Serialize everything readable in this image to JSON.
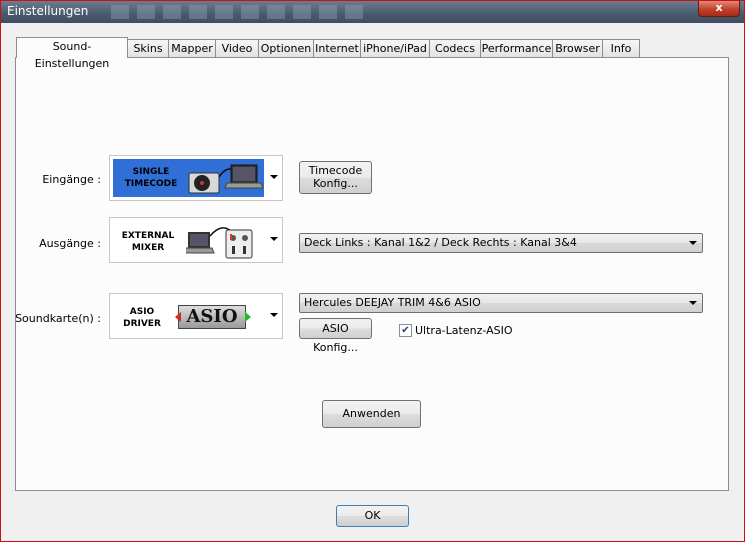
{
  "window": {
    "title": "Einstellungen",
    "close_glyph": "x"
  },
  "tabs": [
    {
      "label": "Sound-Einstellungen",
      "active": true
    },
    {
      "label": "Skins"
    },
    {
      "label": "Mapper"
    },
    {
      "label": "Video"
    },
    {
      "label": "Optionen"
    },
    {
      "label": "Internet"
    },
    {
      "label": "iPhone/iPad"
    },
    {
      "label": "Codecs"
    },
    {
      "label": "Performance"
    },
    {
      "label": "Browser"
    },
    {
      "label": "Info"
    }
  ],
  "inputs": {
    "label": "Eingänge :",
    "image_line1": "SINGLE",
    "image_line2": "TIMECODE",
    "image_icon": "turntable-laptop-icon",
    "timecode_button_line1": "Timecode",
    "timecode_button_line2": "Konfig..."
  },
  "outputs": {
    "label": "Ausgänge :",
    "image_line1": "EXTERNAL",
    "image_line2": "MIXER",
    "image_icon": "laptop-mixer-icon",
    "routing_value": "Deck Links : Kanal 1&2 / Deck Rechts : Kanal 3&4"
  },
  "soundcard": {
    "label": "Soundkarte(n) :",
    "image_line1": "ASIO",
    "image_line2": "DRIVER",
    "image_logo": "ASIO",
    "device_value": "Hercules DEEJAY TRIM 4&6 ASIO",
    "asio_button": "ASIO Konfig...",
    "ultra_latency_label": "Ultra-Latenz-ASIO",
    "ultra_latency_checked": true
  },
  "apply_button": "Anwenden",
  "ok_button": "OK",
  "colors": {
    "selected_image_bg": "#2f6fd6",
    "frame_border": "#cc1010"
  }
}
